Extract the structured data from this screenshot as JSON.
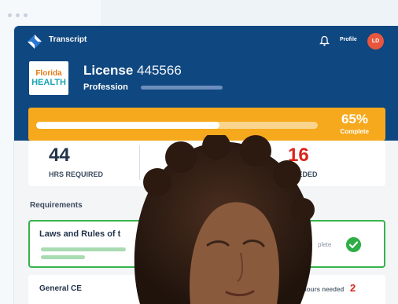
{
  "window": {
    "dots": 3
  },
  "nav": {
    "title": "Transcript",
    "bell_icon": "bell-icon",
    "profile_label": "Profile",
    "avatar_initials": "LD"
  },
  "license": {
    "logo_top": "Florida",
    "logo_bottom": "HEALTH",
    "label": "License",
    "number": "445566",
    "profession_label": "Profession"
  },
  "progress": {
    "percent_text": "65%",
    "status_text": "Complete",
    "fraction": 0.65
  },
  "stats": [
    {
      "value": "44",
      "label": "HRS REQUIRED"
    },
    {
      "value": "16",
      "label": "NEEDED"
    }
  ],
  "requirements": {
    "heading": "Requirements",
    "items": [
      {
        "title": "Laws and Rules of t",
        "status": "plete"
      },
      {
        "title": "General CE",
        "hours_label": "Hours needed",
        "hours_value": "2"
      }
    ]
  },
  "colors": {
    "header": "#0f4780",
    "progress": "#f6a91c",
    "success": "#2fae46",
    "alert": "#d9251c"
  }
}
